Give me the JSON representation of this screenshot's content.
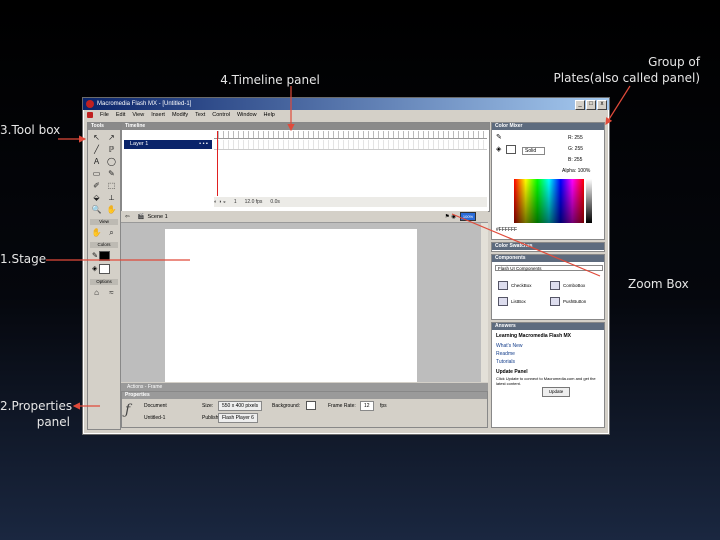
{
  "callouts": {
    "timeline": "4.Timeline panel",
    "group_line1": "Group of",
    "group_line2": "Plates(also called panel)",
    "toolbox": "3.Tool box",
    "stage": "1.Stage",
    "zoom": "Zoom Box",
    "props_line1": "2.Properties",
    "props_line2": "panel"
  },
  "window": {
    "title": "Macromedia Flash MX - [Untitled-1]",
    "controls": [
      "_",
      "□",
      "x"
    ],
    "menu": [
      "File",
      "Edit",
      "View",
      "Insert",
      "Modify",
      "Text",
      "Control",
      "Window",
      "Help"
    ]
  },
  "tools": {
    "header": "Tools",
    "icons": [
      "↖",
      "↗",
      "╱",
      "ℙ",
      "A",
      "◯",
      "▭",
      "✎",
      "✐",
      "⬚",
      "⬙",
      "⟂",
      "🔍",
      "✋"
    ],
    "icon_names": [
      "arrow-tool-icon",
      "subselect-tool-icon",
      "line-tool-icon",
      "lasso-tool-icon",
      "text-tool-icon",
      "oval-tool-icon",
      "rectangle-tool-icon",
      "pencil-tool-icon",
      "brush-tool-icon",
      "free-transform-icon",
      "fill-transform-icon",
      "ink-bottle-icon",
      "zoom-tool-icon",
      "hand-tool-icon"
    ],
    "view_label": "View",
    "colors_label": "Colors",
    "options_label": "Options"
  },
  "timeline": {
    "header": "Timeline",
    "layer": "Layer 1",
    "frame": "1",
    "fps": "12.0 fps",
    "time": "0.0s"
  },
  "scene": {
    "label": "Scene 1",
    "zoom": "100%"
  },
  "actions": {
    "header": "Actions - Frame"
  },
  "properties": {
    "header": "Properties",
    "doc_label": "Document",
    "doc_name": "Untitled-1",
    "size_label": "Size:",
    "size_value": "550 x 400 pixels",
    "background_label": "Background:",
    "framerate_label": "Frame Rate:",
    "framerate_value": "12",
    "fps_unit": "fps",
    "publish_label": "Publish:",
    "publish_value": "Flash Player 6"
  },
  "color_mixer": {
    "header": "Color Mixer",
    "r": "255",
    "g": "255",
    "b": "255",
    "alpha": "100%",
    "fill_type": "Solid",
    "hex": "#FFFFFF"
  },
  "swatches": {
    "header": "Color Swatches"
  },
  "components": {
    "header": "Components",
    "set": "Flash UI Components",
    "items": [
      "CheckBox",
      "ComboBox",
      "ListBox",
      "PushButton"
    ]
  },
  "answers": {
    "header": "Answers",
    "title": "Learning Macromedia Flash MX",
    "links": [
      "What's New",
      "Readme",
      "Tutorials"
    ],
    "update_title": "Update Panel",
    "update_text": "Click Update to connect to Macromedia.com and get the latest content.",
    "update_button": "Update"
  },
  "colors": {
    "arrow": "#e04a3a",
    "titlebar": "#0a246a"
  }
}
